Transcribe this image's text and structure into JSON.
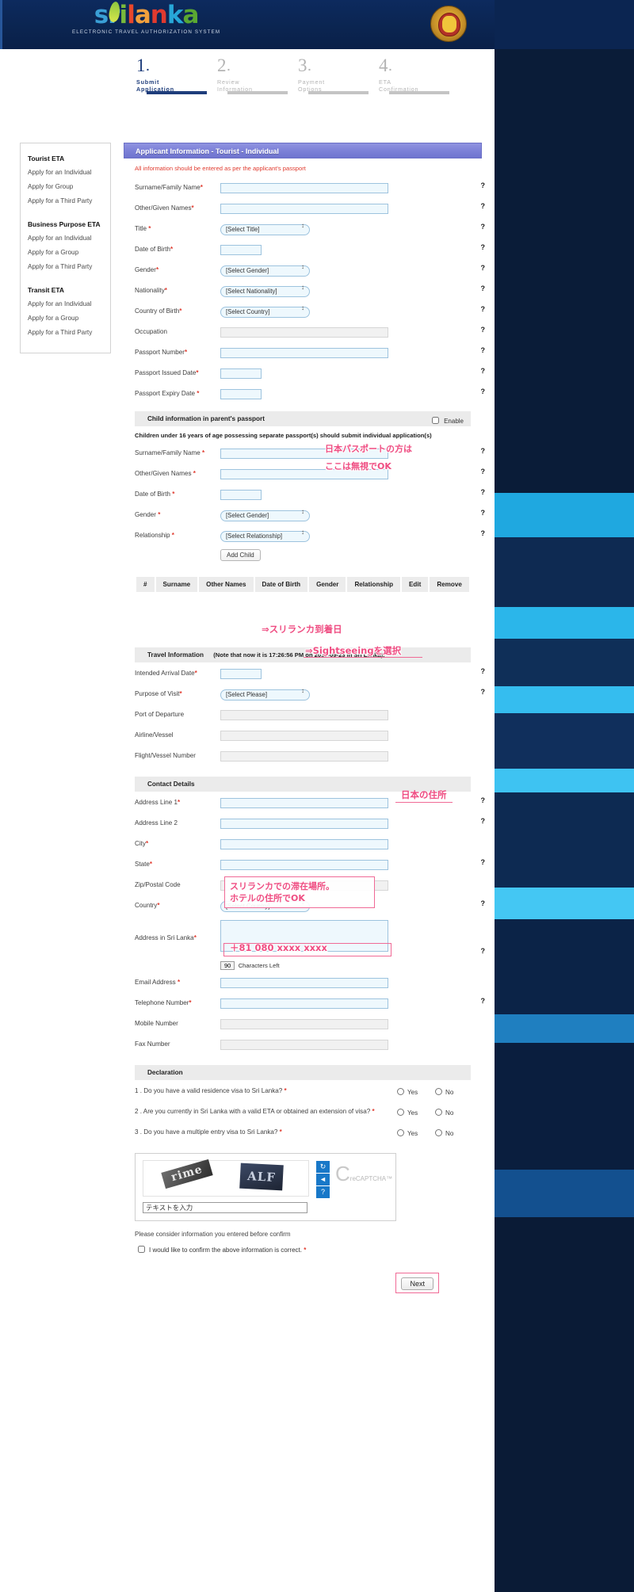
{
  "header": {
    "logo_main": "srilanka",
    "logo_letters": [
      "s",
      "r",
      "i",
      "l",
      "a",
      "n",
      "k",
      "a"
    ],
    "logo_subtitle": "ELECTRONIC TRAVEL AUTHORIZATION SYSTEM",
    "emblem_name": "sri-lanka-national-emblem"
  },
  "steps": [
    {
      "num": "1",
      "line1": "Submit",
      "line2": "Application",
      "state": "active"
    },
    {
      "num": "2",
      "line1": "Review",
      "line2": "Information",
      "state": "inactive"
    },
    {
      "num": "3",
      "line1": "Payment",
      "line2": "Options",
      "state": "inactive"
    },
    {
      "num": "4",
      "line1": "ETA",
      "line2": "Confirmation",
      "state": "inactive"
    }
  ],
  "sidebar": {
    "groups": [
      {
        "title": "Tourist ETA",
        "items": [
          "Apply for an Individual",
          "Apply for Group",
          "Apply for a Third Party"
        ]
      },
      {
        "title": "Business Purpose ETA",
        "items": [
          "Apply for an Individual",
          "Apply for a Group",
          "Apply for a Third Party"
        ]
      },
      {
        "title": "Transit ETA",
        "items": [
          "Apply for an Individual",
          "Apply for a Group",
          "Apply for a Third Party"
        ]
      }
    ]
  },
  "panel": {
    "title": "Applicant Information - Tourist - Individual",
    "notice": "All information should be entered as per the applicant's passport",
    "help_icon": "?"
  },
  "applicant": {
    "fields": [
      {
        "label": "Surname/Family Name",
        "required": true,
        "type": "text",
        "value": "",
        "width": "long",
        "help": true
      },
      {
        "label": "Other/Given Names",
        "required": true,
        "type": "text",
        "value": "",
        "width": "long",
        "help": true
      },
      {
        "label": "Title ",
        "required": true,
        "type": "select",
        "value": "[Select Title]",
        "help": true
      },
      {
        "label": "Date of Birth",
        "required": true,
        "type": "text",
        "value": "",
        "width": "date",
        "help": true
      },
      {
        "label": "Gender",
        "required": true,
        "type": "select",
        "value": "[Select Gender]",
        "help": true
      },
      {
        "label": "Nationality",
        "required": true,
        "type": "select",
        "value": "[Select Nationality]",
        "help": true
      },
      {
        "label": "Country of Birth",
        "required": true,
        "type": "select",
        "value": "[Select Country]",
        "help": true
      },
      {
        "label": "Occupation",
        "required": false,
        "type": "text",
        "value": "",
        "width": "long",
        "disabled": true,
        "help": true
      },
      {
        "label": "Passport Number",
        "required": true,
        "type": "text",
        "value": "",
        "width": "long",
        "help": true
      },
      {
        "label": "Passport Issued Date",
        "required": true,
        "type": "text",
        "value": "",
        "width": "date",
        "help": true
      },
      {
        "label": "Passport Expiry Date ",
        "required": true,
        "type": "text",
        "value": "",
        "width": "date",
        "help": true
      }
    ]
  },
  "child_section": {
    "heading": "Child information in parent's passport",
    "enable_label": "Enable",
    "enable_checked": false,
    "subnote": "Children under 16 years of age possessing separate passport(s) should submit individual application(s)",
    "fields": [
      {
        "label": "Surname/Family Name ",
        "required": true,
        "type": "text",
        "value": "",
        "width": "long",
        "help": true
      },
      {
        "label": "Other/Given Names ",
        "required": true,
        "type": "text",
        "value": "",
        "width": "long",
        "help": true
      },
      {
        "label": "Date of Birth ",
        "required": true,
        "type": "text",
        "value": "",
        "width": "date",
        "help": true
      },
      {
        "label": "Gender ",
        "required": true,
        "type": "select",
        "value": "[Select Gender]",
        "help": true
      },
      {
        "label": "Relationship ",
        "required": true,
        "type": "select",
        "value": "[Select Relationship]",
        "help": true
      }
    ],
    "add_child_label": "Add Child",
    "table_headers": [
      "#",
      "Surname",
      "Other Names",
      "Date of Birth",
      "Gender",
      "Relationship",
      "Edit",
      "Remove"
    ]
  },
  "travel": {
    "heading": "Travel Information",
    "note": "(Note that now it is 17:26:56 PM on 2017-09-23 in Sri Lanka).",
    "fields": [
      {
        "label": "Intended Arrival Date",
        "required": true,
        "type": "text",
        "value": "",
        "width": "date",
        "help": true
      },
      {
        "label": "Purpose of Visit",
        "required": true,
        "type": "select",
        "value": "[Select Please]",
        "help": true
      },
      {
        "label": "Port of Departure",
        "required": false,
        "type": "text",
        "value": "",
        "width": "long",
        "disabled": true
      },
      {
        "label": "Airline/Vessel",
        "required": false,
        "type": "text",
        "value": "",
        "width": "long",
        "disabled": true
      },
      {
        "label": "Flight/Vessel Number",
        "required": false,
        "type": "text",
        "value": "",
        "width": "long",
        "disabled": true
      }
    ]
  },
  "contact": {
    "heading": "Contact Details",
    "fields": [
      {
        "label": "Address Line 1",
        "required": true,
        "type": "text",
        "value": "",
        "width": "long",
        "help": true
      },
      {
        "label": "Address Line 2",
        "required": false,
        "type": "text",
        "value": "",
        "width": "long",
        "help": true
      },
      {
        "label": "City",
        "required": true,
        "type": "text",
        "value": "",
        "width": "long",
        "help": false
      },
      {
        "label": "State",
        "required": true,
        "type": "text",
        "value": "",
        "width": "long",
        "help": true
      },
      {
        "label": "Zip/Postal Code",
        "required": false,
        "type": "text",
        "value": "",
        "width": "long",
        "disabled": true
      },
      {
        "label": "Country",
        "required": true,
        "type": "select",
        "value": "[Select Country]",
        "help": true
      }
    ],
    "sri_lanka_address": {
      "label": "Address in Sri Lanka",
      "required": true,
      "value": "",
      "chars_left": "90",
      "chars_left_label": "Characters Left",
      "help": true
    },
    "tail_fields": [
      {
        "label": "Email Address ",
        "required": true,
        "type": "text",
        "value": "",
        "width": "long",
        "help": false
      },
      {
        "label": "Telephone Number",
        "required": true,
        "type": "text",
        "value": "",
        "width": "long",
        "help": true
      },
      {
        "label": "Mobile Number",
        "required": false,
        "type": "text",
        "value": "",
        "width": "long",
        "disabled": true
      },
      {
        "label": "Fax Number",
        "required": false,
        "type": "text",
        "value": "",
        "width": "long",
        "disabled": true
      }
    ]
  },
  "declaration": {
    "heading": "Declaration",
    "yes_label": "Yes",
    "no_label": "No",
    "questions": [
      {
        "text": "1 . Do you have a valid residence visa to Sri Lanka? ",
        "required": true
      },
      {
        "text": "2 . Are you currently in Sri Lanka with a valid ETA or obtained an extension of visa? ",
        "required": true
      },
      {
        "text": "3 . Do you have a multiple entry visa to Sri Lanka? ",
        "required": true
      }
    ]
  },
  "captcha": {
    "word1": "rime",
    "word2": "ALF",
    "refresh_icon": "↻",
    "audio_icon": "◄",
    "help_icon": "?",
    "brand_small": "reCAPTCHA",
    "brand_tm": "™",
    "input_value": "テキストを入力"
  },
  "footer": {
    "confirm_note": "Please consider information you entered before confirm",
    "confirm_label": "I would like to confirm the above information is correct. ",
    "confirm_required": true,
    "confirm_checked": false,
    "next_label": "Next"
  },
  "annotations": {
    "child_line1": "日本パスポートの方は",
    "child_line2": "ここは無視でOK",
    "arrival": "⇒スリランカ到着日",
    "purpose": "⇒Sightseeingを選択",
    "city": "日本の住所",
    "sri_addr_line1": "スリランカでの滞在場所。",
    "sri_addr_line2": "ホテルの住所でOK",
    "telephone": "＋81 080 xxxx xxxx"
  },
  "colors": {
    "header_blue": "#0b2551",
    "panel_purple": "#7d82d8",
    "accent_red": "#e03b2f",
    "annotation_pink": "#ef4d82",
    "input_blue": "#eef8fd"
  }
}
